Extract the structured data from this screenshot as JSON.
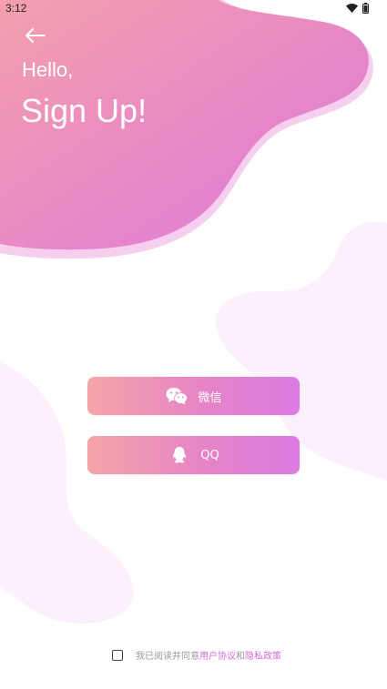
{
  "status_bar": {
    "time": "3:12",
    "icons": [
      "wifi-icon",
      "battery-icon"
    ]
  },
  "header": {
    "back_icon": "back-arrow-icon",
    "greeting": "Hello,",
    "title": "Sign Up!"
  },
  "login_options": [
    {
      "icon": "wechat-icon",
      "label": "微信"
    },
    {
      "icon": "qq-icon",
      "label": "QQ"
    }
  ],
  "agreement": {
    "prefix": "我已阅读并同意",
    "user_agreement": "用户协议",
    "conjunction": "和",
    "privacy_policy": "隐私政策"
  },
  "colors": {
    "gradient_start": "#f4a5a8",
    "gradient_end": "#db7ce3",
    "link": "#d56bd9",
    "background_blob": "#fbf0fb"
  }
}
